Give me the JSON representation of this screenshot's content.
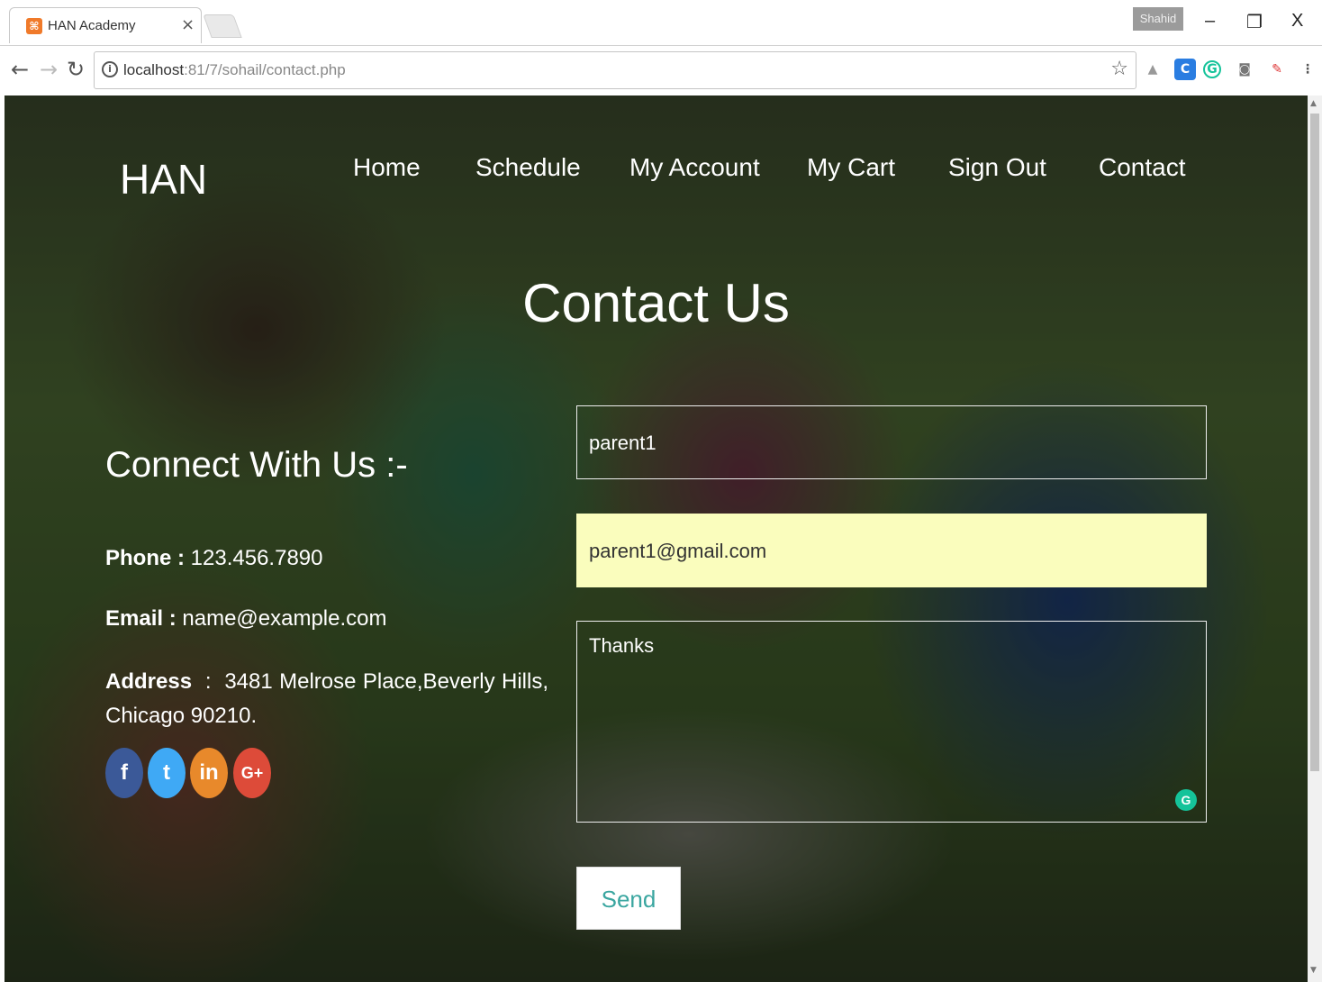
{
  "browser": {
    "tab_title": "HAN Academy",
    "tab_close": "×",
    "profile_name": "Shahid",
    "url_host": "localhost",
    "url_rest": ":81/7/sohail/contact.php",
    "minimize": "–",
    "restore": "❐",
    "close": "X"
  },
  "site": {
    "brand": "HAN",
    "nav": [
      "Home",
      "Schedule",
      "My Account",
      "My Cart",
      "Sign Out",
      "Contact"
    ]
  },
  "contact": {
    "heading": "Contact Us",
    "connect_title": "Connect With Us :-",
    "phone_label": "Phone :",
    "phone_value": "123.456.7890",
    "email_label": "Email :",
    "email_value": "name@example.com",
    "address_label": "Address",
    "address_sep": ":",
    "address_value": "3481 Melrose Place,Beverly Hills, Chicago 90210.",
    "social": [
      "f",
      "t",
      "in",
      "G+"
    ]
  },
  "form": {
    "name_value": "parent1",
    "email_value": "parent1@gmail.com",
    "message_value": "Thanks",
    "send_label": "Send"
  },
  "colors": {
    "facebook": "#3b5998",
    "twitter": "#3fa9f5",
    "linkedin": "#e8892b",
    "google": "#dd4b39",
    "autofill": "#fafdbd",
    "send_text": "#3aa6a0"
  }
}
